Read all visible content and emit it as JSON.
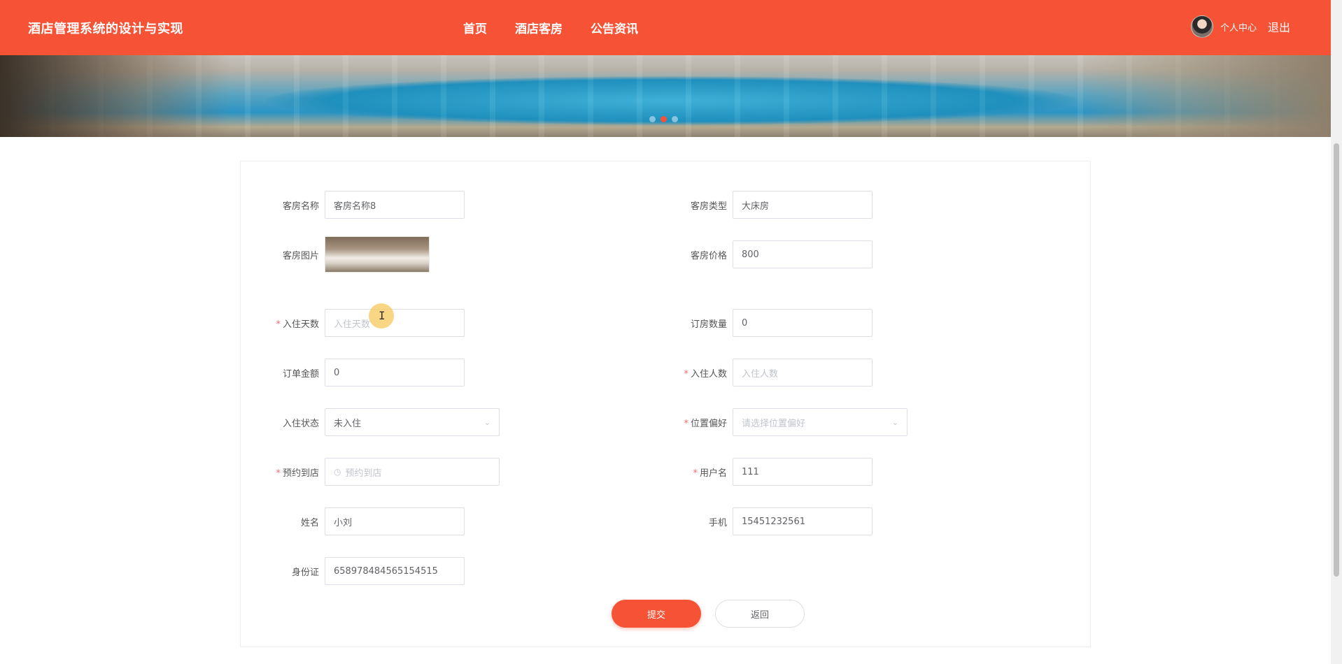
{
  "header": {
    "brand": "酒店管理系统的设计与实现",
    "nav": [
      "首页",
      "酒店客房",
      "公告资讯"
    ],
    "user_center": "个人中心",
    "logout": "退出"
  },
  "banner": {
    "slides": 3,
    "active_slide": 2
  },
  "form": {
    "room_name": {
      "label": "客房名称",
      "value": "客房名称8"
    },
    "room_type": {
      "label": "客房类型",
      "value": "大床房"
    },
    "room_image": {
      "label": "客房图片"
    },
    "room_price": {
      "label": "客房价格",
      "value": "800"
    },
    "stay_days": {
      "label": "入住天数",
      "required": true,
      "placeholder": "入住天数"
    },
    "booking_qty": {
      "label": "订房数量",
      "value": "0"
    },
    "order_amount": {
      "label": "订单金额",
      "value": "0"
    },
    "guest_count": {
      "label": "入住人数",
      "required": true,
      "placeholder": "入住人数"
    },
    "checkin_status": {
      "label": "入住状态",
      "value": "未入住"
    },
    "location_pref": {
      "label": "位置偏好",
      "required": true,
      "placeholder": "请选择位置偏好"
    },
    "arrival": {
      "label": "预约到店",
      "required": true,
      "placeholder": "预约到店"
    },
    "username": {
      "label": "用户名",
      "required": true,
      "value": "111"
    },
    "name": {
      "label": "姓名",
      "value": "小刘"
    },
    "phone": {
      "label": "手机",
      "value": "15451232561"
    },
    "id_card": {
      "label": "身份证",
      "value": "658978484565154515"
    }
  },
  "buttons": {
    "submit": "提交",
    "back": "返回"
  },
  "colors": {
    "primary": "#f65236",
    "required": "#f56c6c"
  }
}
